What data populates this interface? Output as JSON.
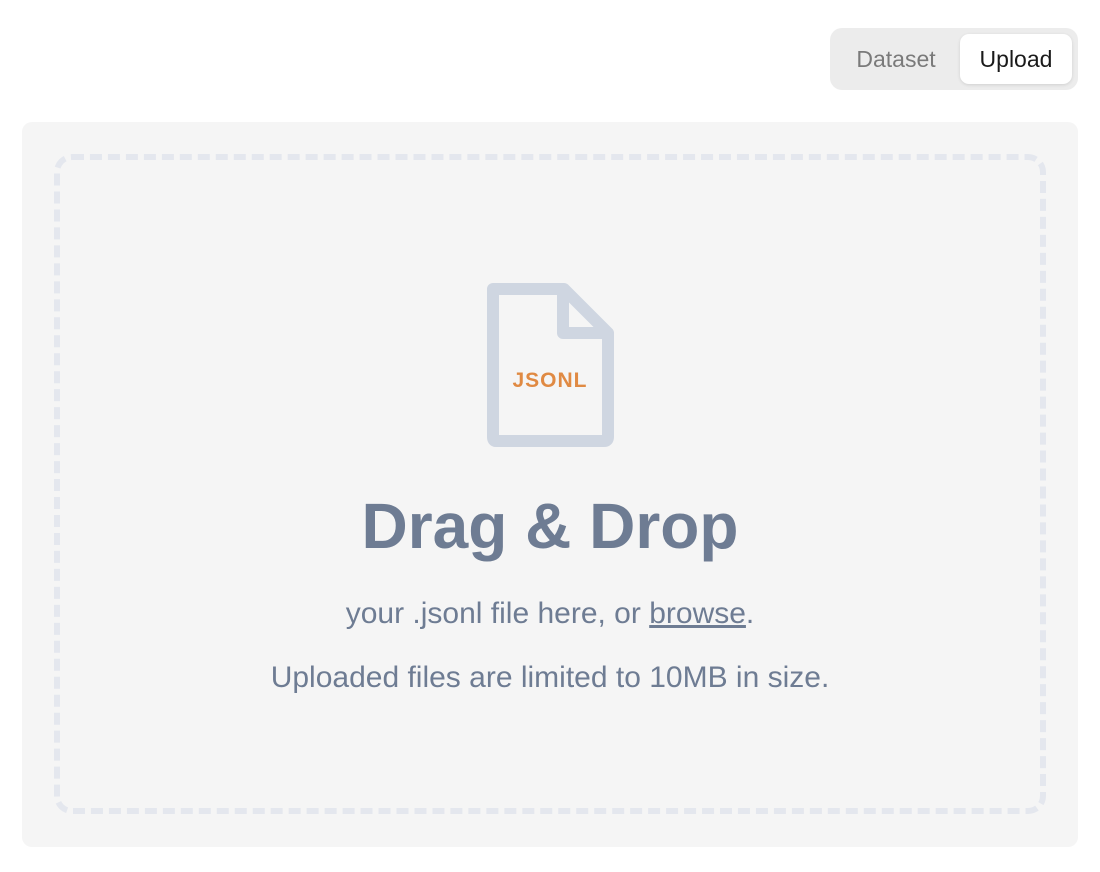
{
  "mode_toggle": {
    "options": [
      {
        "label": "Dataset",
        "selected": false
      },
      {
        "label": "Upload",
        "selected": true
      }
    ]
  },
  "dropzone": {
    "file_icon_label": "JSONL",
    "title": "Drag & Drop",
    "instruction_prefix": "your .jsonl file here, or ",
    "browse_label": "browse",
    "instruction_suffix": ".",
    "limit_text": "Uploaded files are limited to 10MB in size."
  },
  "colors": {
    "icon_outline": "#cfd6e1",
    "icon_label": "#e08a43",
    "text": "#6e7c93",
    "panel_background": "#f5f5f5",
    "dashed_border": "#e4e7ee"
  },
  "icons": {
    "file": "jsonl-file-icon"
  }
}
